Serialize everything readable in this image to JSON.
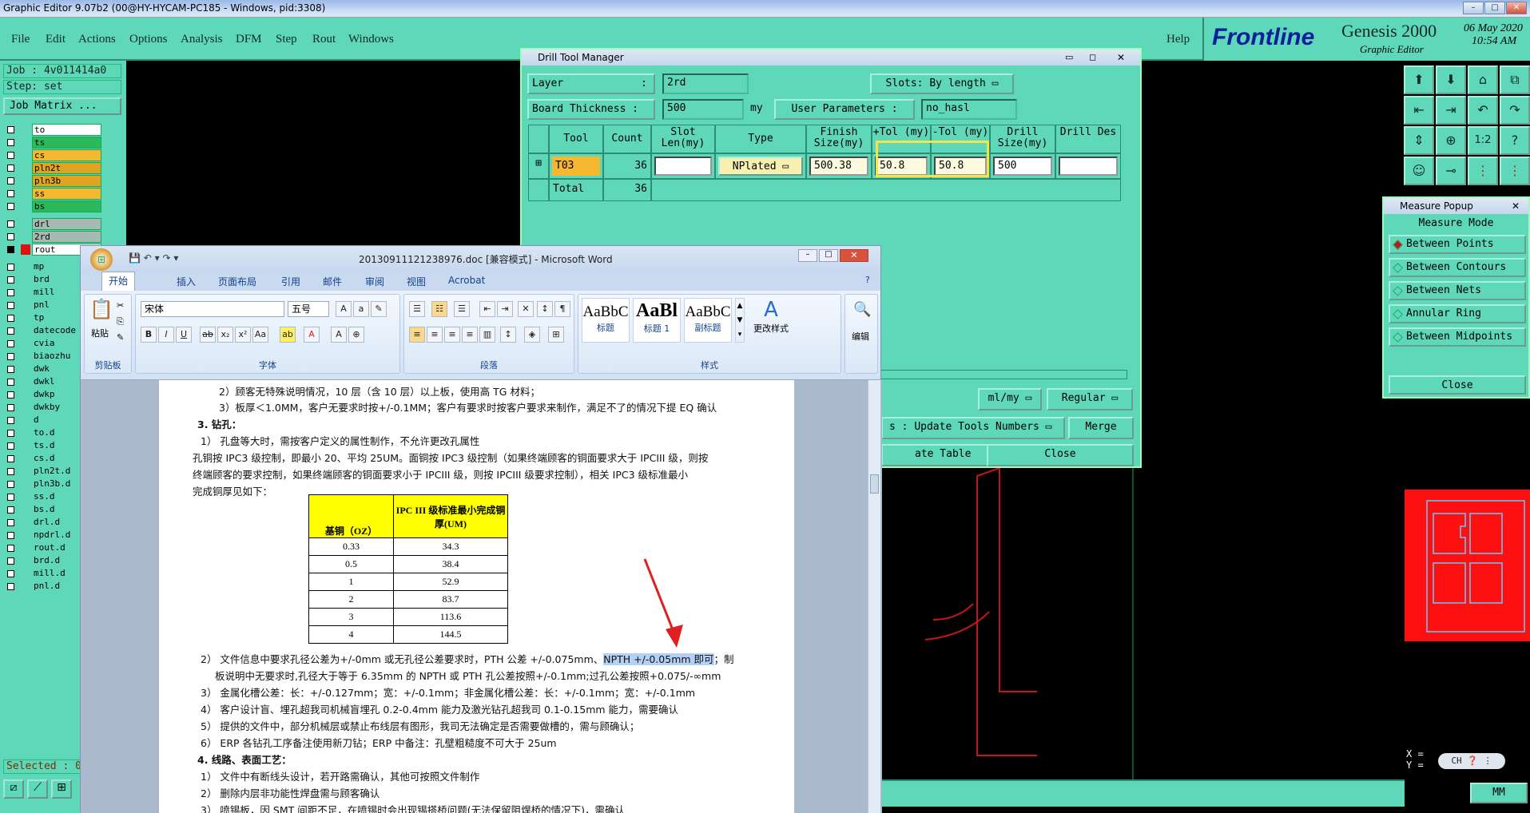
{
  "main_window": {
    "title": "Graphic Editor 9.07b2 (00@HY-HYCAM-PC185 - Windows, pid:3308)",
    "menu": [
      "File",
      "Edit",
      "Actions",
      "Options",
      "Analysis",
      "DFM",
      "Step",
      "Rout",
      "Windows"
    ],
    "help": "Help",
    "logo": "Frontline",
    "product": "Genesis 2000",
    "product_sub": "Graphic Editor",
    "date": "06 May 2020",
    "time": "10:54 AM"
  },
  "left_panel": {
    "job": "Job : 4v011414a0",
    "step": "Step: set",
    "job_matrix": "Job Matrix ...",
    "selected": "Selected : 0",
    "layers": [
      {
        "name": "to",
        "color": "#ffffff"
      },
      {
        "name": "ts",
        "color": "#2db85a"
      },
      {
        "name": "cs",
        "color": "#f5b830"
      },
      {
        "name": "pln2t",
        "color": "#e0a520"
      },
      {
        "name": "pln3b",
        "color": "#e0a520"
      },
      {
        "name": "ss",
        "color": "#f5b830"
      },
      {
        "name": "bs",
        "color": "#2db85a"
      },
      {
        "name": "drl",
        "color": "#a8b8b4"
      },
      {
        "name": "2rd",
        "color": "#a8b8b4"
      },
      {
        "name": "rout",
        "color": "#ffffff"
      },
      {
        "name": "mp",
        "color": ""
      },
      {
        "name": "brd",
        "color": ""
      },
      {
        "name": "mill",
        "color": ""
      },
      {
        "name": "pnl",
        "color": ""
      },
      {
        "name": "tp",
        "color": ""
      },
      {
        "name": "datecode",
        "color": ""
      },
      {
        "name": "cvia",
        "color": ""
      },
      {
        "name": "biaozhu",
        "color": ""
      },
      {
        "name": "dwk",
        "color": ""
      },
      {
        "name": "dwkl",
        "color": ""
      },
      {
        "name": "dwkp",
        "color": ""
      },
      {
        "name": "dwkby",
        "color": ""
      },
      {
        "name": "d",
        "color": ""
      },
      {
        "name": "to.d",
        "color": ""
      },
      {
        "name": "ts.d",
        "color": ""
      },
      {
        "name": "cs.d",
        "color": ""
      },
      {
        "name": "pln2t.d",
        "color": ""
      },
      {
        "name": "pln3b.d",
        "color": ""
      },
      {
        "name": "ss.d",
        "color": ""
      },
      {
        "name": "bs.d",
        "color": ""
      },
      {
        "name": "drl.d",
        "color": ""
      },
      {
        "name": "npdrl.d",
        "color": ""
      },
      {
        "name": "rout.d",
        "color": ""
      },
      {
        "name": "brd.d",
        "color": ""
      },
      {
        "name": "mill.d",
        "color": ""
      },
      {
        "name": "pnl.d",
        "color": ""
      }
    ]
  },
  "drill_tool_manager": {
    "title": "Drill Tool Manager",
    "layer_label": "Layer",
    "layer_value": "2rd",
    "slots_label": "Slots:",
    "slots_value": "By length",
    "board_thickness_label": "Board Thickness :",
    "board_thickness_value": "500",
    "unit": "my",
    "user_params_label": "User Parameters :",
    "user_params_value": "no_hasl",
    "headers": [
      "Tool",
      "Count",
      "Slot Len(my)",
      "Type",
      "Finish Size(my)",
      "+Tol (my)",
      "-Tol (my)",
      "Drill Size(my)",
      "Drill Des"
    ],
    "row": {
      "tool": "T03",
      "count": "36",
      "type": "NPlated",
      "finish": "500.38",
      "ptol": "50.8",
      "ntol": "50.8",
      "drill": "500"
    },
    "total_label": "Total",
    "total_count": "36",
    "units_option": "ml/my",
    "mode_option": "Regular",
    "update_label": "Update Tools Numbers",
    "merge": "Merge",
    "update_table": "ate Table",
    "close": "Close"
  },
  "measure_popup": {
    "title": "Measure Popup",
    "mode_label": "Measure Mode",
    "options": [
      "Between Points",
      "Between Contours",
      "Between Nets",
      "Annular Ring",
      "Between Midpoints"
    ],
    "close": "Close",
    "x_label": "X =",
    "y_label": "Y ="
  },
  "word": {
    "title": "20130911121238976.doc [兼容模式] - Microsoft Word",
    "tabs": [
      "开始",
      "插入",
      "页面布局",
      "引用",
      "邮件",
      "审阅",
      "视图",
      "Acrobat"
    ],
    "font_name": "宋体",
    "font_size": "五号",
    "paste": "粘贴",
    "groups": [
      "剪贴板",
      "字体",
      "段落",
      "样式"
    ],
    "styles": [
      {
        "sample": "AaBbC",
        "name": "标题"
      },
      {
        "sample": "AaBl",
        "name": "标题 1"
      },
      {
        "sample": "AaBbC",
        "name": "副标题"
      }
    ],
    "change_styles": "更改样式",
    "edit": "编辑",
    "lines": [
      "2）顾客无特殊说明情况，10 层（含 10 层）以上板，使用高 TG 材料；",
      "3）板厚＜1.0MM，客户无要求时按+/-0.1MM；客户有要求时按客户要求来制作，满足不了的情况下提 EQ 确认",
      "3.   钻孔：",
      "1）  孔盘等大时，需按客户定义的属性制作，不允许更改孔属性",
      "孔铜按 IPC3 级控制，即最小 20、平均 25UM。面铜按 IPC3 级控制（如果终端顾客的铜面要求大于 IPCIII 级，则按",
      "终端顾客的要求控制，如果终端顾客的铜面要求小于 IPCIII 级，则按 IPCIII 级要求控制），相关 IPC3 级标准最小",
      "完成铜厚见如下："
    ],
    "table": {
      "head1": "基铜（OZ）",
      "head2": "IPC III 级标准最小完成铜厚(UM)",
      "rows": [
        [
          "0.33",
          "34.3"
        ],
        [
          "0.5",
          "38.4"
        ],
        [
          "1",
          "52.9"
        ],
        [
          "2",
          "83.7"
        ],
        [
          "3",
          "113.6"
        ],
        [
          "4",
          "144.5"
        ]
      ]
    },
    "lines2": [
      "2）  文件信息中要求孔径公差为+/-0mm 或无孔径公差要求时，PTH 公差 +/-0.075mm、",
      "NPTH +/-0.05mm 即可",
      "；制",
      "板说明中无要求时,孔径大于等于 6.35mm 的 NPTH 或 PTH 孔公差按照+/-0.1mm;过孔公差按照+0.075/-∞mm",
      "3）  金属化槽公差：长：+/-0.127mm；宽：+/-0.1mm；非金属化槽公差：长：+/-0.1mm；宽：+/-0.1mm",
      "4）  客户设计盲、埋孔超我司机械盲埋孔 0.2-0.4mm 能力及激光钻孔超我司 0.1-0.15mm 能力，需要确认",
      "5）  提供的文件中，部分机械层或禁止布线层有图形，我司无法确定是否需要做槽的，需与顾确认；",
      "6）  ERP 各钻孔工序备注使用新刀钻；ERP 中备注：孔壁粗糙度不可大于 25um",
      "4.   线路、表面工艺：",
      "1）  文件中有断线头设计，若开路需确认，其他可按照文件制作",
      "2）  删除内层非功能性焊盘需与顾客确认",
      "3）  喷锡板，因 SMT 间距不足，在喷锡时会出现锡搭桥问题(无法保留阻焊桥的情况下)，需确认"
    ]
  },
  "status": {
    "units": "MM",
    "ime": "CH"
  },
  "colors": {
    "teal": "#5fd7b9",
    "highlight": "#f5e34a",
    "arrow": "#e02020",
    "outline": "#c01818"
  }
}
